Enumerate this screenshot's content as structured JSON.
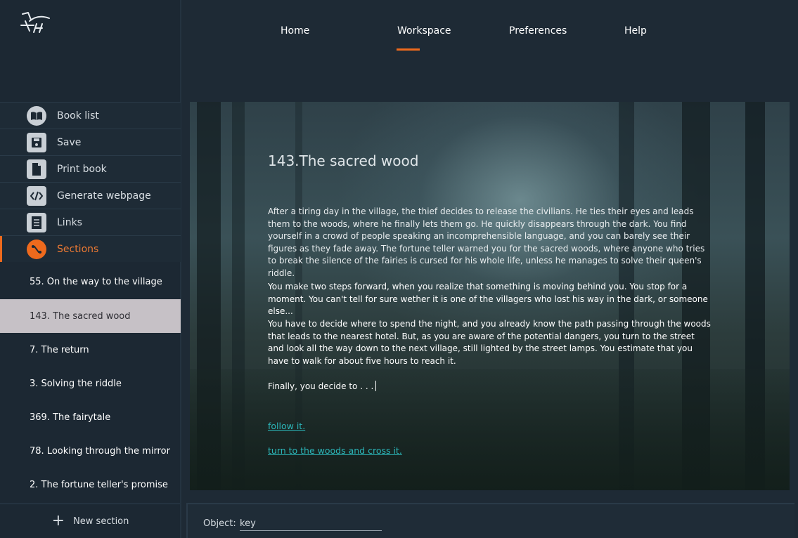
{
  "nav": {
    "home": "Home",
    "workspace": "Workspace",
    "preferences": "Preferences",
    "help": "Help",
    "active": "workspace"
  },
  "menu": {
    "book_list": "Book list",
    "save": "Save",
    "print_book": "Print book",
    "generate_webpage": "Generate webpage",
    "links": "Links",
    "sections": "Sections"
  },
  "sections": [
    "55. On the way to the village",
    "143. The sacred wood",
    "7. The return",
    "3. Solving the riddle",
    "369. The fairytale",
    "78. Looking through the mirror",
    "2. The fortune teller's promise"
  ],
  "new_section": "New section",
  "content": {
    "title": "143.The sacred wood",
    "p1": "After a tiring day in the village, the thief decides to release the civilians. He ties their eyes and leads them to the woods, where he finally lets them go. He quickly disappears through the dark. You find yourself in a crowd of people speaking an incomprehensible language, and you can barely see their figures as they fade away. The fortune teller warned you for the sacred woods, where anyone who tries to break the silence of the fairies is cursed for his whole life, unless he manages to solve their queen's riddle.",
    "p2": "You make two steps forward, when you realize that something is moving behind you. You stop for a moment. You can't tell for sure wether it is one of the villagers who lost his way in the dark, or someone else...",
    "p3": "You have to decide where to spend the night, and you already know the path passing through the woods that leads to the nearest hotel. But, as you are aware of the potential dangers, you turn to the street and look all the way down to the next village, still lighted by the street lamps. You estimate that you have to walk for about five hours to reach it.",
    "p4": "Finally, you decide to . . .",
    "choice1": "follow it.",
    "choice2": "turn to the woods and cross it."
  },
  "object": {
    "label": "Object:",
    "value": "key"
  },
  "colors": {
    "accent": "#ee6a1d",
    "link": "#2bb5b8",
    "selected_bg": "#c6c1c6"
  }
}
